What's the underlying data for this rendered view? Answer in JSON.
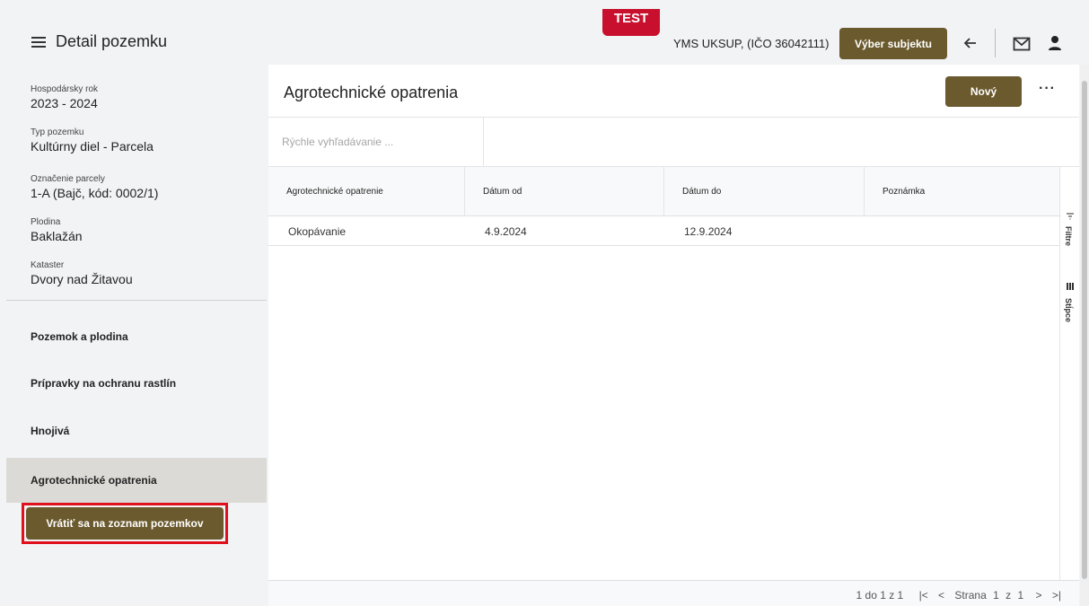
{
  "header": {
    "page_title": "Detail pozemku",
    "test_badge": "TEST",
    "subject": "YMS UKSUP, (IČO 36042111)",
    "subject_button": "Výber subjektu"
  },
  "sidebar": {
    "info": [
      {
        "label": "Hospodársky rok",
        "value": "2023 - 2024"
      },
      {
        "label": "Typ pozemku",
        "value": "Kultúrny diel - Parcela"
      },
      {
        "label": "Označenie parcely",
        "value": "1-A (Bajč, kód: 0002/1)"
      },
      {
        "label": "Plodina",
        "value": "Baklažán"
      },
      {
        "label": "Kataster",
        "value": "Dvory nad Žitavou"
      }
    ],
    "nav": [
      {
        "label": "Pozemok a plodina"
      },
      {
        "label": "Prípravky na ochranu rastlín"
      },
      {
        "label": "Hnojivá"
      },
      {
        "label": "Agrotechnické opatrenia"
      }
    ],
    "return_button": "Vrátiť sa na zoznam pozemkov"
  },
  "main": {
    "title": "Agrotechnické opatrenia",
    "new_button": "Nový",
    "more_label": "···",
    "search_placeholder": "Rýchle vyhľadávanie ...",
    "columns": [
      "Agrotechnické opatrenie",
      "Dátum od",
      "Dátum do",
      "Poznámka"
    ],
    "rows": [
      [
        "Okopávanie",
        "4.9.2024",
        "12.9.2024",
        ""
      ]
    ],
    "tools": {
      "filter": "Filtre",
      "columns": "Stĺpce"
    },
    "pager": {
      "summary": "1 do 1 z 1",
      "page_label": "Strana",
      "page": "1",
      "of": "z",
      "total": "1"
    }
  }
}
